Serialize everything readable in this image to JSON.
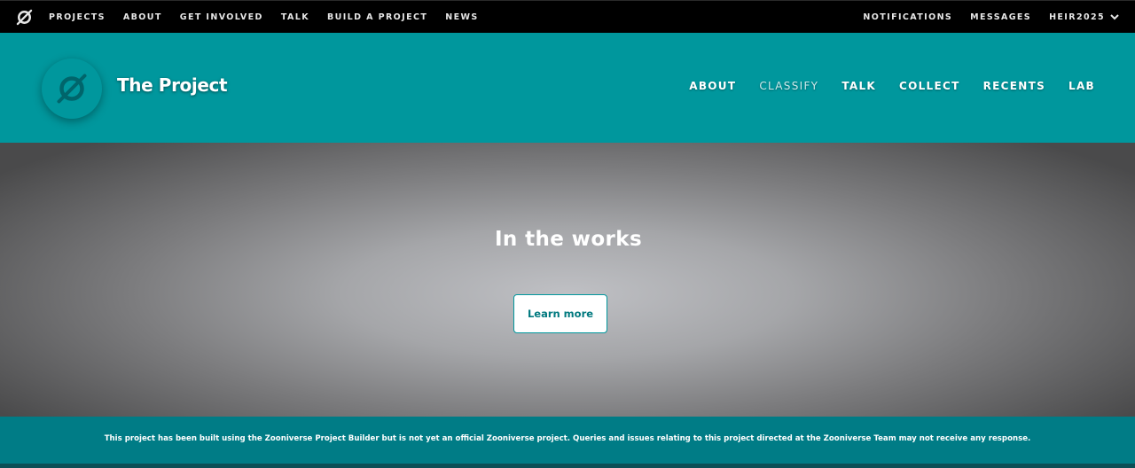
{
  "topnav": {
    "logo_icon": "zooniverse-logo-icon",
    "links": [
      "PROJECTS",
      "ABOUT",
      "GET INVOLVED",
      "TALK",
      "BUILD A PROJECT",
      "NEWS"
    ],
    "notifications": "NOTIFICATIONS",
    "messages": "MESSAGES",
    "user": "HEIR2025",
    "user_menu_icon": "chevron-down-icon"
  },
  "project": {
    "avatar_icon": "zooniverse-logo-icon",
    "title": "The Project",
    "nav": [
      "ABOUT",
      "CLASSIFY",
      "TALK",
      "COLLECT",
      "RECENTS",
      "LAB"
    ],
    "active_nav": "CLASSIFY"
  },
  "hero": {
    "heading": "In the works",
    "button_label": "Learn more"
  },
  "footer": {
    "notice": "This project has been built using the Zooniverse Project Builder but is not yet an official Zooniverse project. Queries and issues relating to this project directed at the Zooniverse Team may not receive any response."
  },
  "colors": {
    "brand_teal": "#00979d",
    "notice_teal": "#007c86",
    "topbar": "#000000"
  }
}
